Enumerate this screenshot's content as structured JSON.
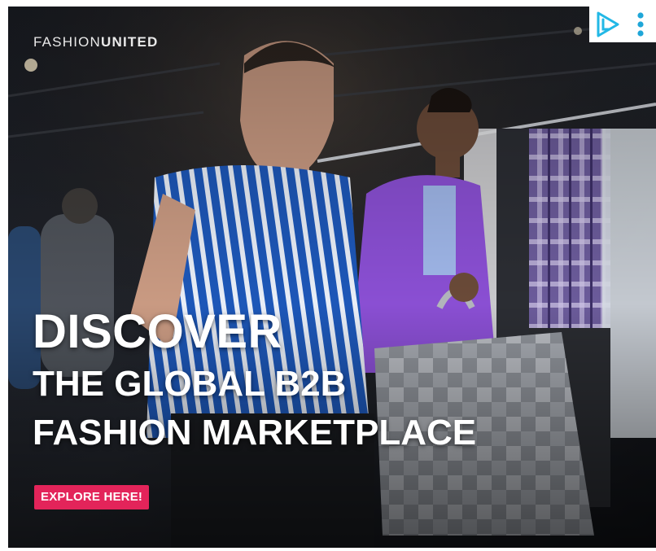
{
  "logo": {
    "part_light": "FASHION",
    "part_bold": "UNITED"
  },
  "headline": {
    "line1": "DISCOVER",
    "line2": "THE GLOBAL B2B",
    "line3": "FASHION MARKETPLACE"
  },
  "cta": {
    "label": "EXPLORE HERE!"
  },
  "colors": {
    "cta_bg": "#e3245a",
    "ad_icon": "#22b8e6",
    "menu_dots": "#1fa6d8"
  },
  "icons": {
    "adchoices": "adchoices-play-icon",
    "menu": "kebab-menu-icon"
  }
}
